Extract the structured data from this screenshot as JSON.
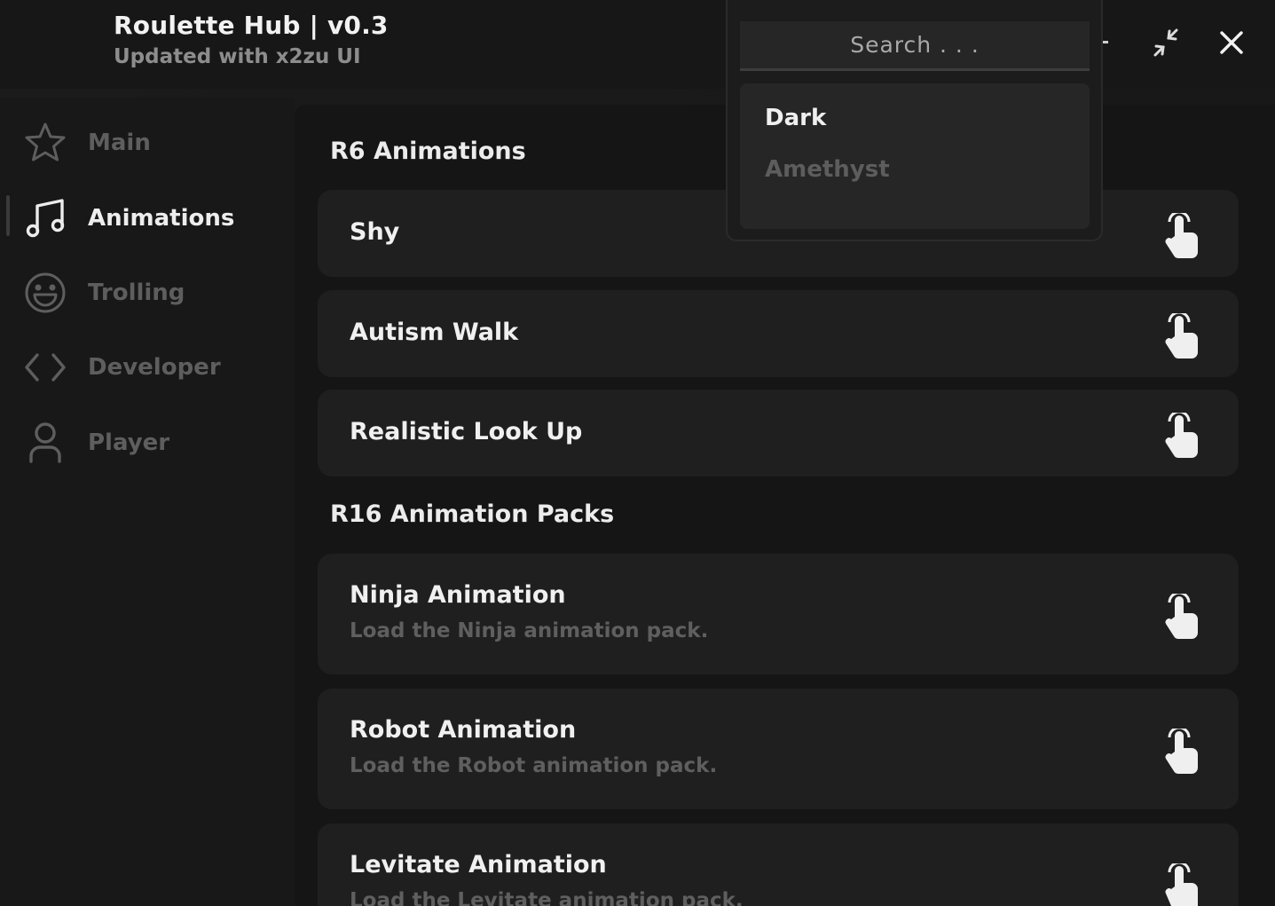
{
  "header": {
    "title": "Roulette Hub | v0.3",
    "subtitle": "Updated with x2zu UI"
  },
  "window_controls": {
    "minimize_icon": "minus-icon",
    "resize_icon": "collapse-icon",
    "close_icon": "close-icon"
  },
  "sidebar": {
    "items": [
      {
        "label": "Main",
        "icon": "star-icon",
        "active": false
      },
      {
        "label": "Animations",
        "icon": "music-note-icon",
        "active": true
      },
      {
        "label": "Trolling",
        "icon": "smiley-icon",
        "active": false
      },
      {
        "label": "Developer",
        "icon": "code-icon",
        "active": false
      },
      {
        "label": "Player",
        "icon": "user-icon",
        "active": false
      }
    ]
  },
  "main": {
    "sections": [
      {
        "title": "R6 Animations",
        "buttons": [
          {
            "title": "Shy"
          },
          {
            "title": "Autism Walk"
          },
          {
            "title": "Realistic Look Up"
          }
        ]
      },
      {
        "title": "R16 Animation Packs",
        "buttons": [
          {
            "title": "Ninja Animation",
            "description": "Load the Ninja animation pack."
          },
          {
            "title": "Robot Animation",
            "description": "Load the Robot animation pack."
          },
          {
            "title": "Levitate Animation",
            "description": "Load the Levitate animation pack."
          }
        ]
      }
    ]
  },
  "theme_dropdown": {
    "search_placeholder": "Search . . .",
    "options": [
      "Dark",
      "Amethyst"
    ],
    "selected": "Dark"
  },
  "colors": {
    "background": "#151515",
    "card": "#1f1f1f",
    "text_primary": "#f0f0f0",
    "text_muted": "#5f5f5f"
  }
}
